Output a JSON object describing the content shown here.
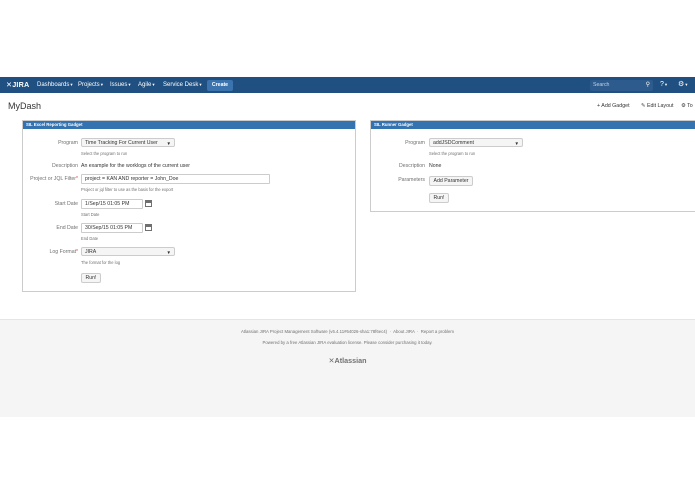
{
  "nav": {
    "logo": "JIRA",
    "items": [
      "Dashboards",
      "Projects",
      "Issues",
      "Agile",
      "Service Desk"
    ],
    "create_label": "Create",
    "search_placeholder": "Search"
  },
  "page": {
    "title": "MyDash",
    "actions": [
      "Add Gadget",
      "Edit Layout",
      "To"
    ]
  },
  "excel_gadget": {
    "title": "SIL Excel Reporting Gadget",
    "program_label": "Program",
    "program_value": "Time Tracking For Current User",
    "program_help": "Select the program to run",
    "description_label": "Description",
    "description_value": "An example for the worklogs of the current user",
    "filter_label": "Project or JQL Filter",
    "filter_value": "project = KAN AND reporter = John_Doe",
    "filter_help": "Project or jql filter to use as the basis for the export",
    "start_label": "Start Date",
    "start_value": "1/Sep/15 01:05 PM",
    "start_help": "Start Date",
    "end_label": "End Date",
    "end_value": "30/Sep/15 01:05 PM",
    "end_help": "End Date",
    "format_label": "Log Format",
    "format_value": "JIRA",
    "format_help": "The format for the log",
    "run_label": "Run!"
  },
  "runner_gadget": {
    "title": "SIL Runner Gadget",
    "program_label": "Program",
    "program_value": "addJSDComment",
    "program_help": "Select the program to run",
    "description_label": "Description",
    "description_value": "None",
    "parameters_label": "Parameters",
    "add_param_label": "Add Parameter",
    "run_label": "Run!"
  },
  "footer": {
    "line1_text": "Atlassian JIRA Project Management Software (v6.4.11#64026-sha1:78f6ec4)",
    "about": "About JIRA",
    "report": "Report a problem",
    "line2": "Powered by a free Atlassian JIRA evaluation license. Please consider purchasing it today.",
    "brand": "Atlassian"
  },
  "colors": {
    "nav": "#205081",
    "create": "#3b73af",
    "gadget_header": "#3572b0"
  }
}
